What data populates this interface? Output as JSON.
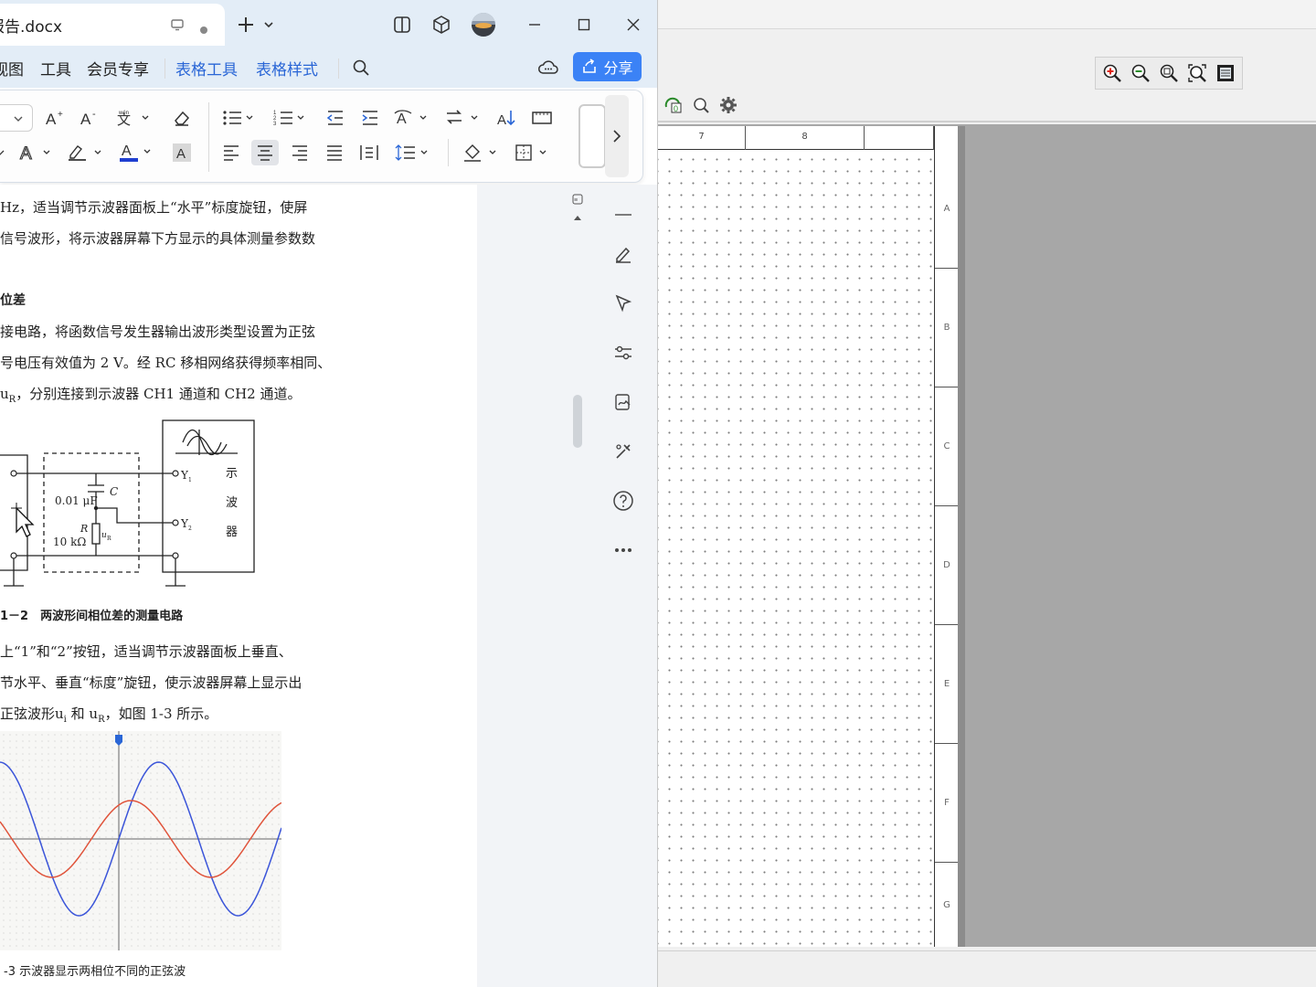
{
  "wps": {
    "tab_title": "报告.docx",
    "menu": {
      "view": "视图",
      "tools": "工具",
      "member": "会员专享",
      "table_tools": "表格工具",
      "table_style": "表格样式",
      "share": "分享"
    },
    "colors": {
      "accent": "#3b82f6",
      "ctx_menu": "#2a66d6",
      "font_color_bar": "#1f3fd0",
      "wave_blue": "#3b55d9",
      "wave_red": "#e0533a"
    },
    "doc": {
      "lines": [
        "Hz，适当调节示波器面板上“水平”标度旋钮，使屏",
        "信号波形，将示波器屏幕下方显示的具体测量参数数"
      ],
      "heading": "位差",
      "para2": [
        "接电路，将函数信号发生器输出波形类型设置为正弦",
        "号电压有效值为 2 V。经 RC 移相网络获得频率相同、",
        "u",
        "，分别连接到示波器 CH1 通道和 CH2 通道。"
      ],
      "para2_sub": "R",
      "circuit": {
        "cap_value": "0.01 μF",
        "cap_label": "C",
        "res_label": "R",
        "res_value": "10 kΩ",
        "ur_label": "u",
        "ur_sub": "R",
        "y1": "Y",
        "y1_sub": "1",
        "y2": "Y",
        "y2_sub": "2",
        "scope_chars": [
          "示",
          "波",
          "器"
        ]
      },
      "figure_caption": "1－2　两波形间相位差的测量电路",
      "para3": [
        "上“1”和“2”按钮，适当调节示波器面板上垂直、",
        "节水平、垂直“标度”旋钮，使示波器屏幕上显示出",
        "正弦波形u",
        " 和 u",
        "，如图 1-3 所示。"
      ],
      "para3_sub_i": "i",
      "para3_sub_r": "R",
      "figure2_caption": "-3  示波器显示两相位不同的正弦波"
    }
  },
  "cad": {
    "top_ruler": [
      "7",
      "8"
    ],
    "right_ruler": [
      "A",
      "B",
      "C",
      "D",
      "E",
      "F",
      "G"
    ]
  }
}
